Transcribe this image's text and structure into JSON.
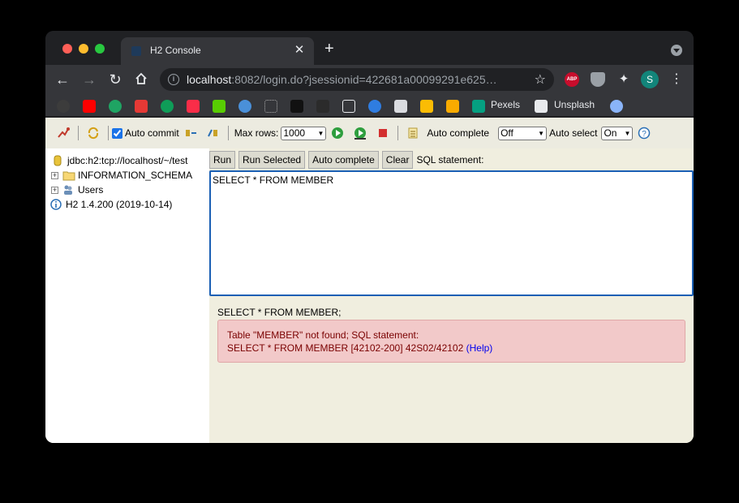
{
  "browser": {
    "tab_title": "H2 Console",
    "tab_close": "✕",
    "new_tab": "+",
    "url_host": "localhost",
    "url_rest": ":8082/login.do?jsessionid=422681a00099291e625…",
    "profile_initial": "S",
    "abp_label": "ABP",
    "bookmarks": {
      "pexels": "Pexels",
      "unsplash": "Unsplash"
    }
  },
  "h2": {
    "toolbar": {
      "auto_commit": "Auto commit",
      "max_rows_label": "Max rows:",
      "max_rows_value": "1000",
      "auto_complete_label": "Auto complete",
      "auto_complete_value": "Off",
      "auto_select_label": "Auto select",
      "auto_select_value": "On",
      "help": "?"
    },
    "tree": {
      "connection": "jdbc:h2:tcp://localhost/~/test",
      "schema": "INFORMATION_SCHEMA",
      "users": "Users",
      "version": "H2 1.4.200 (2019-10-14)"
    },
    "buttons": {
      "run": "Run",
      "run_selected": "Run Selected",
      "auto_complete": "Auto complete",
      "clear": "Clear"
    },
    "sql_label": "SQL statement:",
    "sql_text": "SELECT * FROM MEMBER",
    "result_statement": "SELECT * FROM MEMBER;",
    "error_line1": "Table \"MEMBER\" not found; SQL statement:",
    "error_line2": "SELECT * FROM MEMBER [42102-200] 42S02/42102",
    "error_help": "(Help)"
  }
}
